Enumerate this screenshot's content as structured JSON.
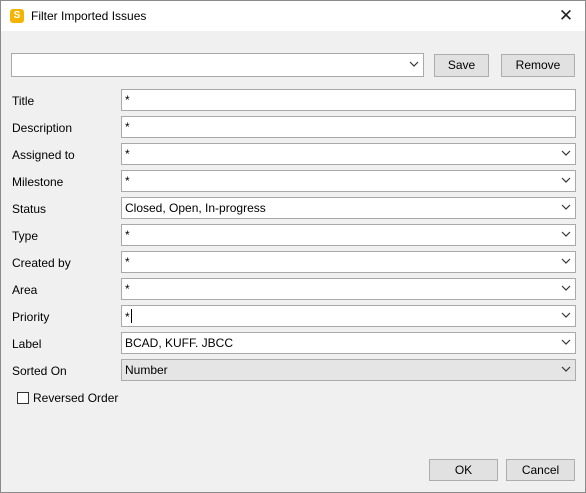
{
  "window": {
    "title": "Filter Imported Issues",
    "app_icon_letter": "S",
    "close_glyph": "✕"
  },
  "preset": {
    "value": "",
    "save_label": "Save",
    "remove_label": "Remove"
  },
  "fields": [
    {
      "label": "Title",
      "value": "*",
      "kind": "text"
    },
    {
      "label": "Description",
      "value": "*",
      "kind": "text"
    },
    {
      "label": "Assigned to",
      "value": "*",
      "kind": "select"
    },
    {
      "label": "Milestone",
      "value": "*",
      "kind": "select"
    },
    {
      "label": "Status",
      "value": "Closed, Open, In-progress",
      "kind": "select"
    },
    {
      "label": "Type",
      "value": "*",
      "kind": "select"
    },
    {
      "label": "Created by",
      "value": "*",
      "kind": "select"
    },
    {
      "label": "Area",
      "value": "*",
      "kind": "select"
    },
    {
      "label": "Priority",
      "value": "*",
      "kind": "select"
    },
    {
      "label": "Label",
      "value": "BCAD, KUFF. JBCC",
      "kind": "select"
    },
    {
      "label": "Sorted On",
      "value": "Number",
      "kind": "dropdown-list"
    }
  ],
  "reversed_order": {
    "label": "Reversed Order",
    "checked": false
  },
  "footer": {
    "ok_label": "OK",
    "cancel_label": "Cancel"
  },
  "icons": {
    "app": "app-logo-icon",
    "close": "close-icon",
    "dropdown": "chevron-down-icon"
  },
  "colors": {
    "app_icon": "#f5b400",
    "window_bg": "#f0f0f0",
    "sorted_on_bg": "#e5e5e5"
  }
}
